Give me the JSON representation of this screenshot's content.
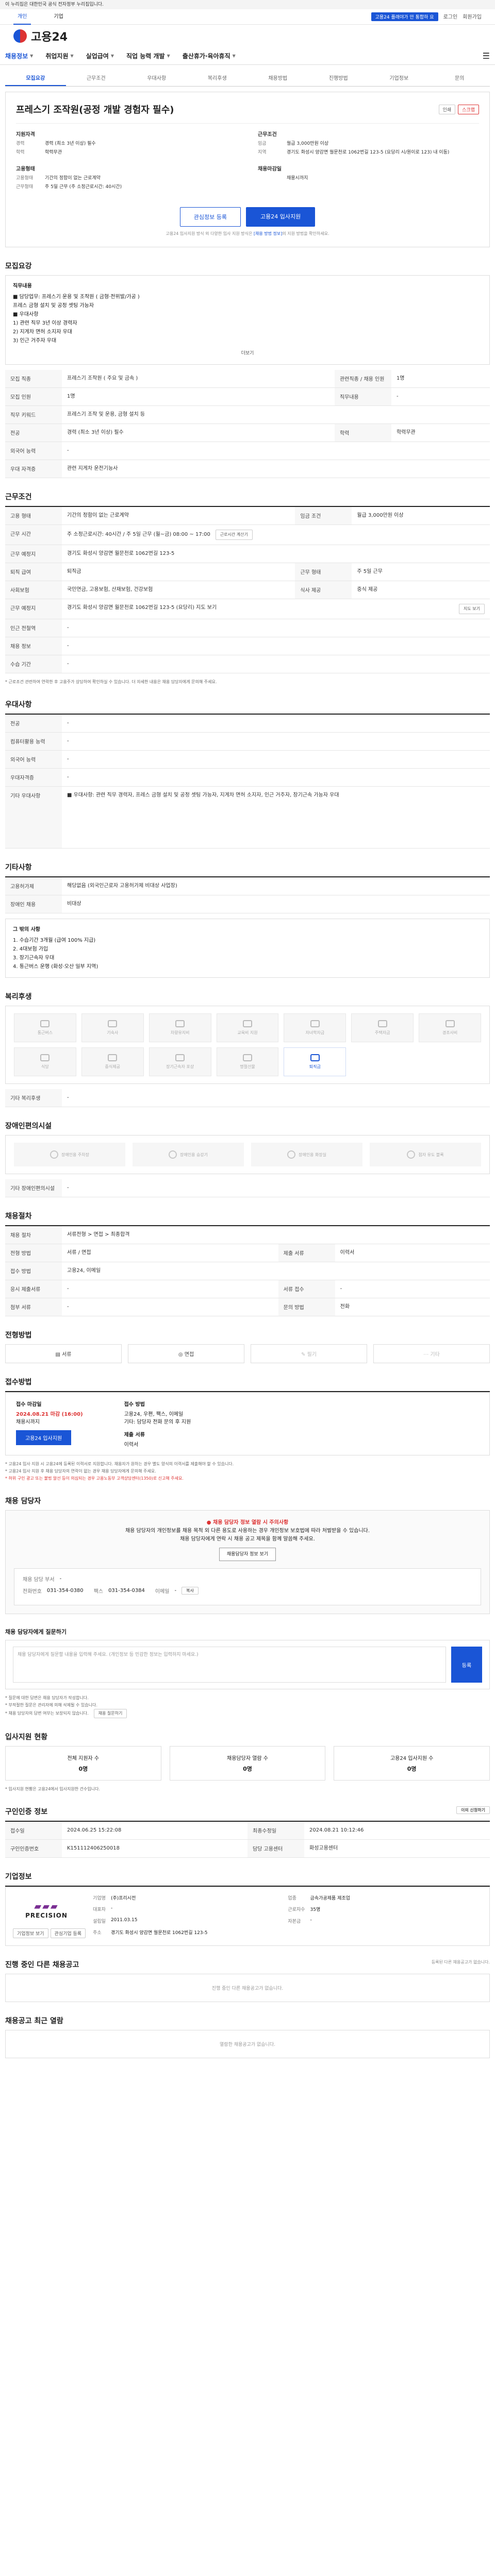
{
  "gov_banner": "이 누리집은 대한민국 공식 전자정부 누리집입니다.",
  "topbar": {
    "tabs": [
      "개인",
      "기업"
    ],
    "promo": "고용24 플래야가 안 통합하 요",
    "login": "로그인",
    "join": "회원가입"
  },
  "logo": {
    "text": "고용24"
  },
  "gnb": {
    "items": [
      "채용정보",
      "취업지원",
      "실업급여",
      "직업 능력 개발",
      "출산휴가·육아휴직"
    ]
  },
  "tabs": [
    "모집요강",
    "근무조건",
    "우대사항",
    "복리후생",
    "채용방법",
    "진행방법",
    "기업정보",
    "문의"
  ],
  "summary": {
    "corp_name": "",
    "title": "프레스기 조작원(공정 개발 경험자 필수)",
    "print": "인쇄",
    "scrap": "스크랩",
    "left_title": "지원자격",
    "left": [
      {
        "k": "경력",
        "v": "경력 (최소 3년 이상) 필수"
      },
      {
        "k": "학력",
        "v": "학력무관"
      }
    ],
    "right_title": "근무조건",
    "right": [
      {
        "k": "임금",
        "v": "월급 3,000만원 이상"
      },
      {
        "k": "지역",
        "v": "경기도 화성시 양감면 월문천로 1062번길 123-5 (요당리 시/원이로 123) 내 이동)"
      }
    ],
    "left2_title": "고용형태",
    "left2": [
      {
        "k": "고용형태",
        "v": "기간의 정함이 없는 근로계약"
      },
      {
        "k": "근무형태",
        "v": "주 5일 근무 (주 소정근로시간: 40시간)"
      }
    ],
    "right2_title": "채용마감일",
    "right2": [
      {
        "k": "",
        "v": "채용시까지"
      }
    ],
    "bookmark_btn": "관심정보 등록",
    "apply_btn": "고용24 입사지원",
    "notice": "고용24 입사지원 방식 외 다양한 입사 지원 방식은 ",
    "notice_link": "[채용 방법 정보]",
    "notice_tail": "의 지원 방법을 확인하세요."
  },
  "job_detail": {
    "heading": "모집요강",
    "sub": "직무내용",
    "lines": [
      "■ 담당업무: 프레스기 운용 및 조작원 ( 금형·전위발/가공 )",
      "   프레스 금형 설치 및 공정 셋팅 가능자",
      "■ 우대사항",
      "   1) 관련 직무 3년 이상 경력자",
      "   2) 지게차 면허 소지자 우대",
      "   3) 인근 거주자 우대"
    ],
    "more": "더보기"
  },
  "recruit_table": {
    "rows": [
      {
        "k": "모집 직종",
        "v": "프레스기 조작원 ( 주요 및 금속 )",
        "k2": "관련직종 / 채용 인원",
        "v2": "1명"
      },
      {
        "k": "모집 인원",
        "v": "1명",
        "k2": "직무내용",
        "v2": "-"
      },
      {
        "k": "직무 키워드",
        "v": "프레스기 조작 및 운용, 금형 설치 등",
        "k2": "",
        "v2": ""
      },
      {
        "k": "전공",
        "v": "경력 (최소 3년 이상) 필수",
        "k2": "학력",
        "v2": "학력무관"
      },
      {
        "k": "외국어 능력",
        "v": "-",
        "k2": "",
        "v2": ""
      },
      {
        "k": "우대 자격증",
        "v": "관련 지게차 운전기능사",
        "k2": "",
        "v2": ""
      }
    ]
  },
  "work": {
    "heading": "근무조건",
    "rows": [
      {
        "k": "고용 형태",
        "v": "기간의 정함이 없는 근로계약",
        "k2": "임금 조건",
        "v2": "월급 3,000만원 이상"
      },
      {
        "k": "근무 시간",
        "v": "주 소정근로시간: 40시간 / 주 5일 근무 (월~금) 08:00 ~ 17:00",
        "k2": "",
        "v2": ""
      },
      {
        "k": "근무 예정지",
        "v": "경기도 화성시 양감면 월문천로 1062번길 123-5",
        "k2": "",
        "v2": ""
      },
      {
        "k": "퇴직 급여",
        "v": "퇴직금",
        "k2": "근무 형태",
        "v2": "주 5일 근무"
      },
      {
        "k": "사회보험",
        "v": "국민연금, 고용보험, 산재보험, 건강보험",
        "k2": "식사 제공",
        "v2": "중식 제공"
      },
      {
        "k": "근무 예정지",
        "v": "경기도 화성시 양감면 월문천로 1062번길 123-5 (요당리) 지도 보기",
        "k2": "",
        "v2": ""
      },
      {
        "k": "인근 전철역",
        "v": "-",
        "k2": "",
        "v2": ""
      },
      {
        "k": "채용 정보",
        "v": "-",
        "k2": "",
        "v2": ""
      },
      {
        "k": "수습 기간",
        "v": "-",
        "k2": "",
        "v2": ""
      }
    ],
    "map_btn": "지도 보기",
    "work_btn": "근로시간 계산기",
    "footnote": "* 근로조건 관련하여 연락한 후 고용주가 상담하여 확인하실 수 있습니다. 더 자세한 내용은 채용 담당자에게 문의해 주세요."
  },
  "pref": {
    "heading": "우대사항",
    "rows": [
      {
        "k": "전공",
        "v": "-"
      },
      {
        "k": "컴퓨터활용 능력",
        "v": "-"
      },
      {
        "k": "외국어 능력",
        "v": "-"
      },
      {
        "k": "우대자격증",
        "v": "-"
      },
      {
        "k": "기타 우대사항",
        "v": "■ 우대사항: 관련 직무 경력자, 프레스 금형 설치 및 공정 셋팅 가능자, 지게차 면허 소지자, 인근 거주자, 장기근속 가능자 우대"
      }
    ]
  },
  "etc": {
    "heading": "기타사항",
    "rows": [
      {
        "k": "고용허가제",
        "v": "해당없음 (외국인근로자 고용허가제 비대상 사업장)"
      },
      {
        "k": "장애인 채용",
        "v": "비대상"
      }
    ],
    "box_title": "그 밖의 사항",
    "box_lines": [
      "1. 수습기간 3개월 (급여 100% 지급)",
      "2. 4대보험 가입",
      "3. 장기근속자 우대",
      "4. 통근버스 운행 (화성·오산 일부 지역)"
    ]
  },
  "welfare": {
    "heading": "복리후생",
    "items": [
      {
        "label": "통근버스",
        "on": false
      },
      {
        "label": "기숙사",
        "on": false
      },
      {
        "label": "차량유지비",
        "on": false
      },
      {
        "label": "교육비 지원",
        "on": false
      },
      {
        "label": "자녀학자금",
        "on": false
      },
      {
        "label": "주택자금",
        "on": false
      },
      {
        "label": "경조사비",
        "on": false
      },
      {
        "label": "식당",
        "on": false
      },
      {
        "label": "중식제공",
        "on": false
      },
      {
        "label": "장기근속자 포상",
        "on": false
      },
      {
        "label": "명절선물",
        "on": false
      },
      {
        "label": "퇴직금",
        "on": true
      }
    ],
    "other_label": "기타 복리후생",
    "other_value": "-"
  },
  "disability": {
    "heading": "장애인편의시설",
    "items": [
      "장애인용 주차장",
      "장애인용 승강기",
      "장애인용 화장실",
      "점자 유도 블록"
    ],
    "other_label": "기타 장애인편의시설",
    "other_value": "-"
  },
  "process": {
    "heading": "채용절차",
    "rows": [
      {
        "k": "채용 절차",
        "v": "서류전형 > 면접 > 최종합격",
        "k2": "",
        "v2": ""
      },
      {
        "k": "전형 방법",
        "v": "서류 / 면접",
        "k2": "제출 서류",
        "v2": "이력서"
      },
      {
        "k": "접수 방법",
        "v": "고용24, 이메일",
        "k2": "",
        "v2": ""
      },
      {
        "k": "응시 제출서류",
        "v": "-",
        "k2": "서류 접수",
        "v2": "-"
      },
      {
        "k": "첨부 서류",
        "v": "-",
        "k2": "문의 방법",
        "v2": "전화"
      }
    ]
  },
  "method": {
    "heading": "전형방법",
    "items": [
      {
        "label": "서류",
        "on": true
      },
      {
        "label": "면접",
        "on": true
      },
      {
        "label": "필기",
        "on": false
      },
      {
        "label": "기타",
        "on": false
      }
    ]
  },
  "apply": {
    "heading": "접수방법",
    "deadline_label": "접수 마감일",
    "deadline": "2024.08.21 마감 (16:00)",
    "deadline_sub": "채용시까지",
    "apply_btn": "고용24 입사지원",
    "docs_label": "접수 방법",
    "docs": "고용24, 우편, 팩스, 이메일",
    "docs_sub": "기타: 담당자 전화 문의 후 지원",
    "form_label": "제출 서류",
    "form_value": "이력서",
    "notes": [
      "* 고용24 입사 지원 시 고용24에 등록된 이력서로 지원합니다. 채용자가 원하는 경우 별도 양식의 이력서를 제출해야 할 수 있습니다.",
      "* 고용24 입사 지원 후 채용 담당자의 연락이 없는 경우 채용 담당자에게 문의해 주세요.",
      "* 허위 구인 광고 또는 불법 알선 등이 의심되는 경우 고용노동부 고객상담센터(1350)로 신고해 주세요."
    ]
  },
  "contact": {
    "heading": "채용 담당자",
    "warn_title": "채용 담당자 정보 열람 시 주의사항",
    "warn_lines": [
      "채용 담당자의 개인정보를 채용 목적 외 다른 용도로 사용하는 경우 개인정보 보호법에 따라 처벌받을 수 있습니다.",
      "채용 담당자에게 연락 시 채용 공고 제목을 함께 말씀해 주세요."
    ],
    "warn_btn": "채용담당자 정보 보기",
    "dept_label": "채용 담당 부서",
    "dept": "-",
    "tel_label": "전화번호",
    "tel": "031-354-0380",
    "fax_label": "팩스",
    "fax": "031-354-0384",
    "email_label": "이메일",
    "email": "-",
    "copy_btn": "복사"
  },
  "ask": {
    "heading": "채용 담당자에게 질문하기",
    "placeholder": "채용 담당자에게 질문할 내용을 입력해 주세요. (개인정보 등 민감한 정보는 입력하지 마세요.)",
    "btn": "등록",
    "notes": [
      "* 질문에 대한 답변은 채용 담당자가 작성합니다.",
      "* 부적절한 질문은 관리자에 의해 삭제될 수 있습니다.",
      "* 채용 담당자의 답변 여부는 보장되지 않습니다."
    ],
    "link_btn": "채용 질문하기"
  },
  "stats": {
    "heading": "입사지원 현황",
    "items": [
      {
        "label": "전체 지원자 수",
        "value": "0명"
      },
      {
        "label": "채용담당자 열람 수",
        "value": "0명"
      },
      {
        "label": "고용24 입사지원 수",
        "value": "0명"
      }
    ],
    "note": "* 입사지원 현황은 고용24에서 입사지원한 건수입니다."
  },
  "meta": {
    "heading": "구인인증 정보",
    "rows": [
      {
        "k": "접수일",
        "v": "2024.06.25 15:22:08",
        "k2": "최종수정일",
        "v2": "2024.08.21 10:12:46"
      },
      {
        "k": "구인인증번호",
        "v": "K151112406250018",
        "k2": "담당 고용센터",
        "v2": "화성고용센터"
      }
    ],
    "btn": "이의 신청하기"
  },
  "company": {
    "heading": "기업정보",
    "logo1": "PRECISION",
    "logo2": "",
    "rows": [
      {
        "k": "기업명",
        "v": "(주)프리시전",
        "k2": "업종",
        "v2": "금속가공제품 제조업"
      },
      {
        "k": "대표자",
        "v": "-",
        "k2": "근로자수",
        "v2": "35명"
      },
      {
        "k": "설립일",
        "v": "2011.03.15",
        "k2": "자본금",
        "v2": "-"
      },
      {
        "k": "주소",
        "v": "경기도 화성시 양감면 월문천로 1062번길 123-5",
        "k2": "",
        "v2": ""
      }
    ],
    "btns": [
      "기업정보 보기",
      "관심기업 등록"
    ]
  },
  "related": {
    "heading": "진행 중인 다른 채용공고",
    "right": "등록된 다른 채용공고가 없습니다.",
    "empty": "진행 중인 다른 채용공고가 없습니다."
  },
  "recent": {
    "heading": "채용공고 최근 열람",
    "empty": "열람한 채용공고가 없습니다."
  }
}
